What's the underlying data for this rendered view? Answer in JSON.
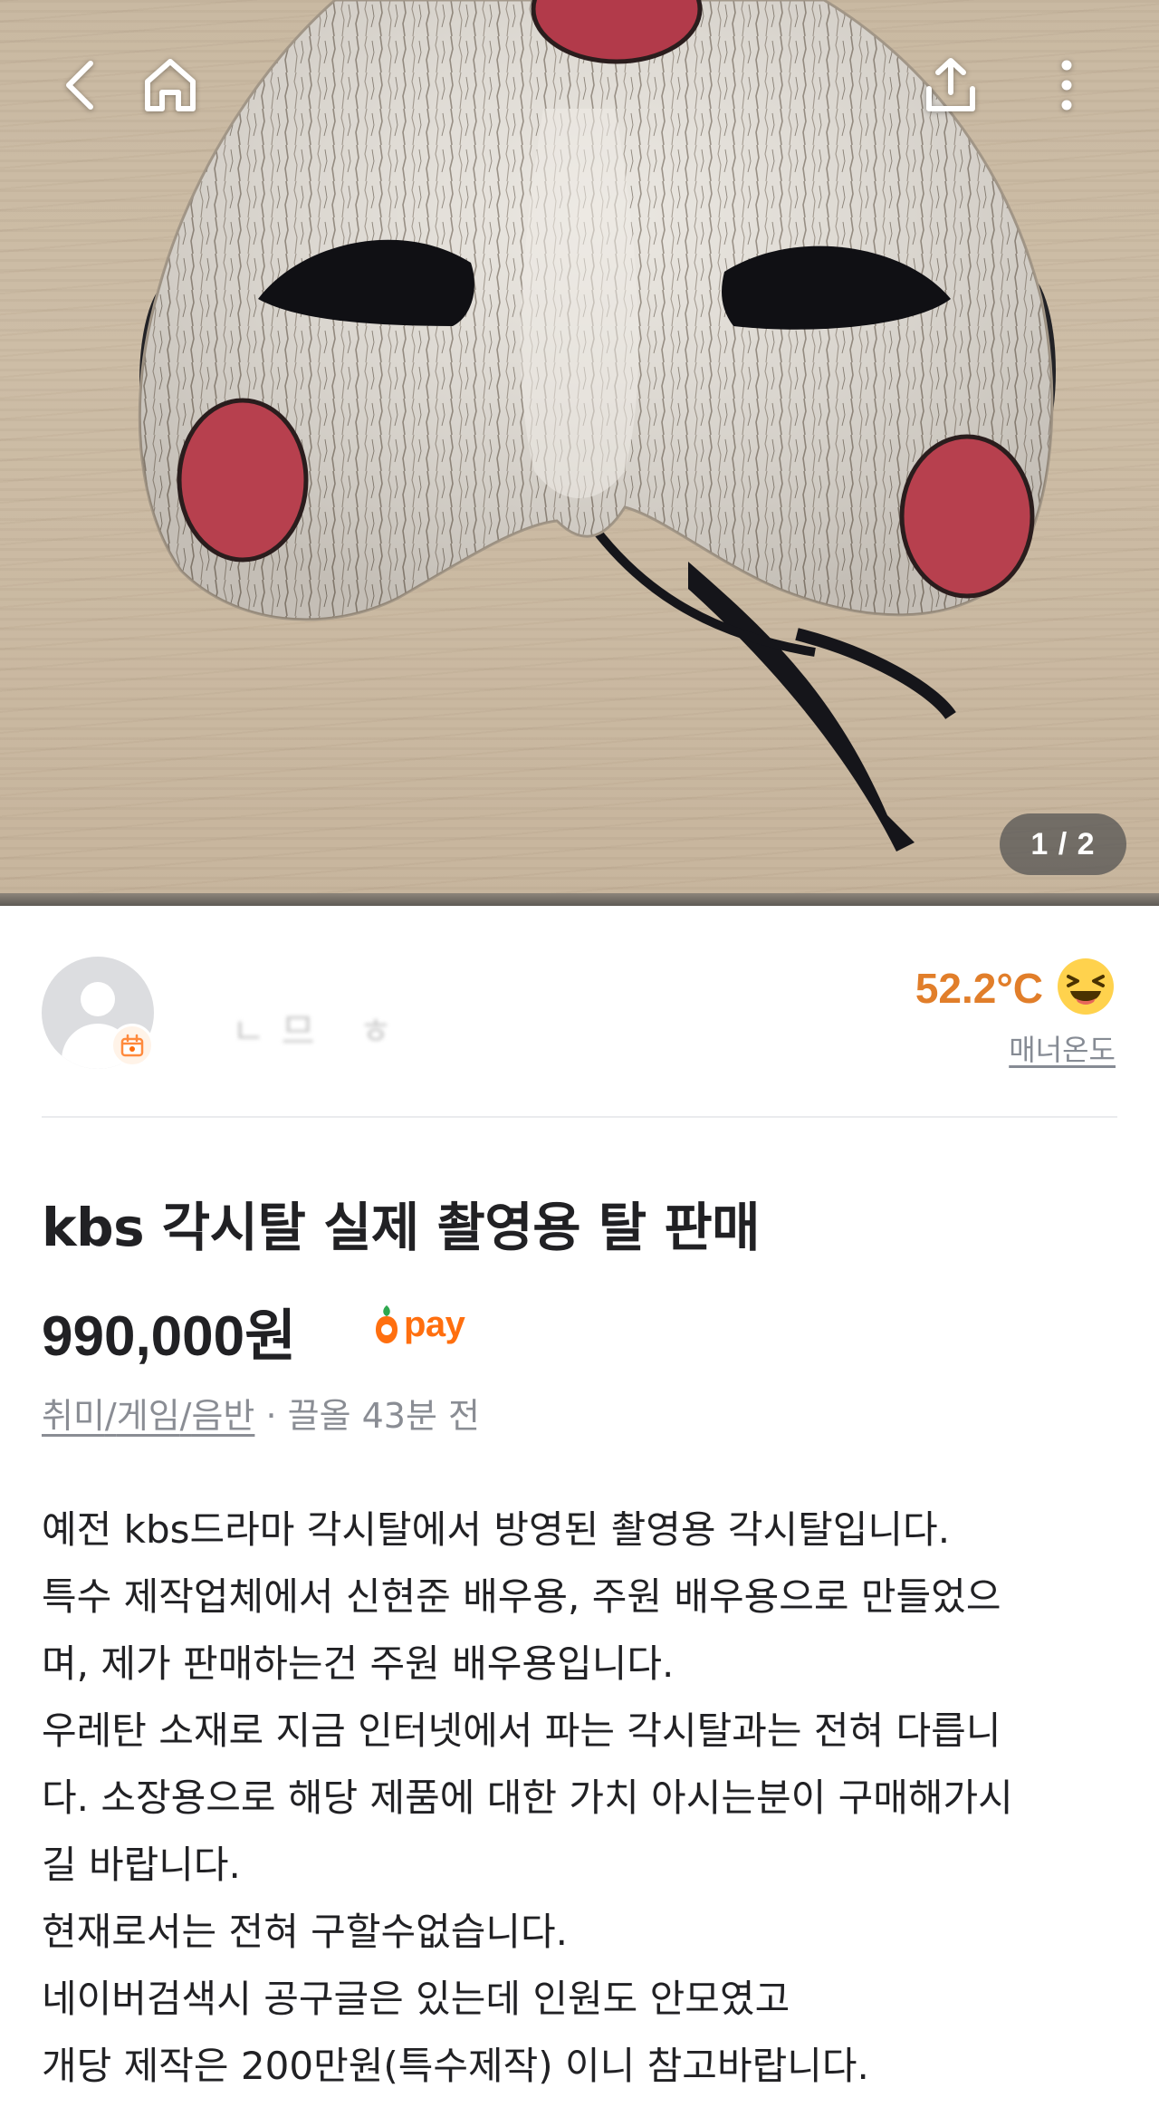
{
  "photo": {
    "counter": "1 / 2"
  },
  "topbar": {
    "icons": [
      "back-icon",
      "home-icon",
      "share-icon",
      "more-vertical-icon"
    ]
  },
  "seller": {
    "nickname_blurred": "ㄴ므 ㅎ",
    "temperature": "52.2°C",
    "manner_label": "매너온도",
    "temperature_color": "#e17e2a"
  },
  "product": {
    "title": "kbs 각시탈 실제 촬영용 탈 판매",
    "price": "990,000원",
    "pay_label": "pay",
    "category_parts": [
      "취미",
      "게임",
      "음반"
    ],
    "category_sep": "/",
    "meta_suffix": " · 끌올 43분 전",
    "description_lines": [
      "예전 kbs드라마 각시탈에서 방영된 촬영용 각시탈입니다.",
      "특수 제작업체에서 신현준 배우용, 주원 배우용으로 만들었으",
      "며, 제가 판매하는건 주원 배우용입니다.",
      "우레탄 소재로 지금 인터넷에서 파는 각시탈과는 전혀 다릅니",
      "다. 소장용으로 해당 제품에 대한 가치 아시는분이 구매해가시",
      "길 바랍니다.",
      "현재로서는 전혀 구할수없습니다.",
      "네이버검색시 공구글은 있는데 인원도 안모였고",
      "개당 제작은 200만원(특수제작) 이니 참고바랍니다."
    ]
  },
  "colors": {
    "brand_orange": "#ff6f0f",
    "text_primary": "#212124",
    "text_secondary": "#868b94"
  }
}
